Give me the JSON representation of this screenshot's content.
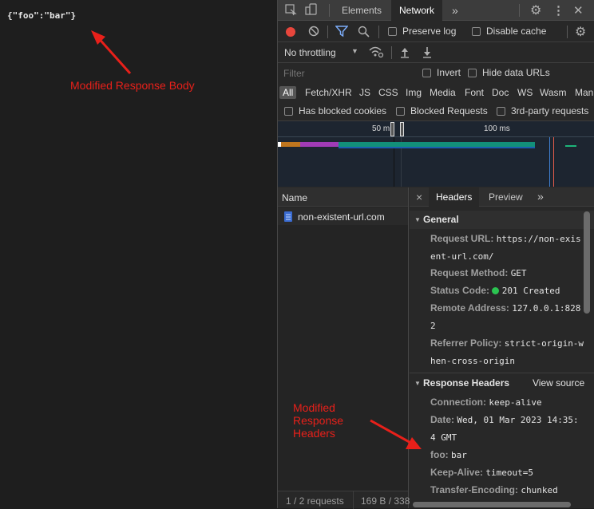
{
  "page": {
    "body_text": "{\"foo\":\"bar\"}"
  },
  "annotations": {
    "body_note": "Modified Response Body",
    "headers_note": "Modified Response Headers",
    "color": "#e8201a"
  },
  "devtools": {
    "tabs": [
      "Elements",
      "Network"
    ],
    "active_tab": "Network",
    "more_tabs": "»",
    "toolbar": {
      "preserve_log": "Preserve log",
      "disable_cache": "Disable cache",
      "throttling": "No throttling"
    },
    "filter": {
      "placeholder": "Filter",
      "invert": "Invert",
      "hide_data_urls": "Hide data URLs"
    },
    "types": [
      "All",
      "Fetch/XHR",
      "JS",
      "CSS",
      "Img",
      "Media",
      "Font",
      "Doc",
      "WS",
      "Wasm",
      "Man"
    ],
    "blocking": {
      "has_blocked_cookies": "Has blocked cookies",
      "blocked_requests": "Blocked Requests",
      "third_party": "3rd-party requests"
    },
    "timeline": {
      "tick1": "50 m",
      "tick2": "100 ms"
    },
    "list": {
      "header": "Name",
      "items": [
        "non-existent-url.com"
      ]
    },
    "status_bar": {
      "requests": "1 / 2 requests",
      "transferred": "169 B / 338"
    },
    "detail_tabs": {
      "close": "×",
      "headers": "Headers",
      "preview": "Preview",
      "more": "»"
    },
    "general": {
      "title": "General",
      "request_url_key": "Request URL:",
      "request_url_1": "https://non-exis",
      "request_url_2": "ent-url.com/",
      "request_method_key": "Request Method:",
      "request_method": "GET",
      "status_code_key": "Status Code:",
      "status_code": "201 Created",
      "remote_address_key": "Remote Address:",
      "remote_address_1": "127.0.0.1:828",
      "remote_address_2": "2",
      "referrer_policy_key": "Referrer Policy:",
      "referrer_policy_1": "strict-origin-w",
      "referrer_policy_2": "hen-cross-origin"
    },
    "response_headers": {
      "title": "Response Headers",
      "view_source": "View source",
      "connection_key": "Connection:",
      "connection": "keep-alive",
      "date_key": "Date:",
      "date_1": "Wed, 01 Mar 2023 14:35:",
      "date_2": "4 GMT",
      "foo_key": "foo:",
      "foo": "bar",
      "keep_alive_key": "Keep-Alive:",
      "keep_alive": "timeout=5",
      "transfer_encoding_key": "Transfer-Encoding:",
      "transfer_encoding": "chunked"
    }
  }
}
